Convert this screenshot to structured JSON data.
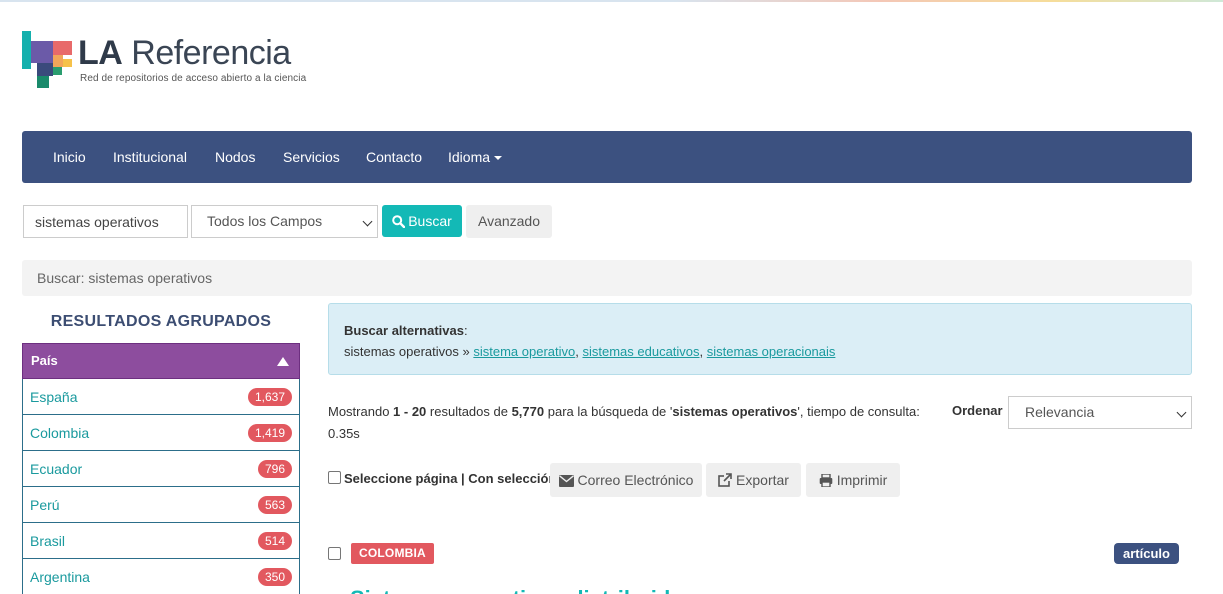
{
  "logo": {
    "title_bold": "LA",
    "title_rest": " Referencia",
    "subtitle": "Red de repositorios de acceso abierto a la ciencia"
  },
  "nav": {
    "items": [
      "Inicio",
      "Institucional",
      "Nodos",
      "Servicios",
      "Contacto"
    ],
    "language_label": "Idioma"
  },
  "search": {
    "query": "sistemas operativos",
    "field": "Todos los Campos",
    "submit_label": "Buscar",
    "advanced_label": "Avanzado"
  },
  "breadcrumb": "Buscar: sistemas operativos",
  "sidebar": {
    "title": "RESULTADOS AGRUPADOS",
    "facet_title": "País",
    "items": [
      {
        "label": "España",
        "count": "1,637"
      },
      {
        "label": "Colombia",
        "count": "1,419"
      },
      {
        "label": "Ecuador",
        "count": "796"
      },
      {
        "label": "Perú",
        "count": "563"
      },
      {
        "label": "Brasil",
        "count": "514"
      },
      {
        "label": "Argentina",
        "count": "350"
      }
    ]
  },
  "alternatives": {
    "label": "Buscar alternativas",
    "query": "sistemas operativos »",
    "links": [
      "sistema operativo",
      "sistemas educativos",
      "sistemas operacionais"
    ]
  },
  "results_info": {
    "prefix": "Mostrando ",
    "range": "1 - 20",
    "mid": " resultados de ",
    "total": "5,770",
    "for_text": " para la búsqueda de '",
    "query": "sistemas operativos",
    "suffix": "', tiempo de consulta: 0.35s"
  },
  "sort": {
    "label": "Ordenar",
    "value": "Relevancia"
  },
  "selection": {
    "label": "Seleccione página | Con selección:",
    "email_label": "Correo Electrónico",
    "export_label": "Exportar",
    "print_label": "Imprimir"
  },
  "result": {
    "country": "COLOMBIA",
    "type": "artículo",
    "title_partial": "Sistemas operativos distribuidos"
  },
  "colors": {
    "navbar": "#3c5180",
    "accent_teal": "#13b9b6",
    "facet_header": "#8d4d9e",
    "badge_red": "#e2585f",
    "alert_bg": "#dbeef6"
  }
}
